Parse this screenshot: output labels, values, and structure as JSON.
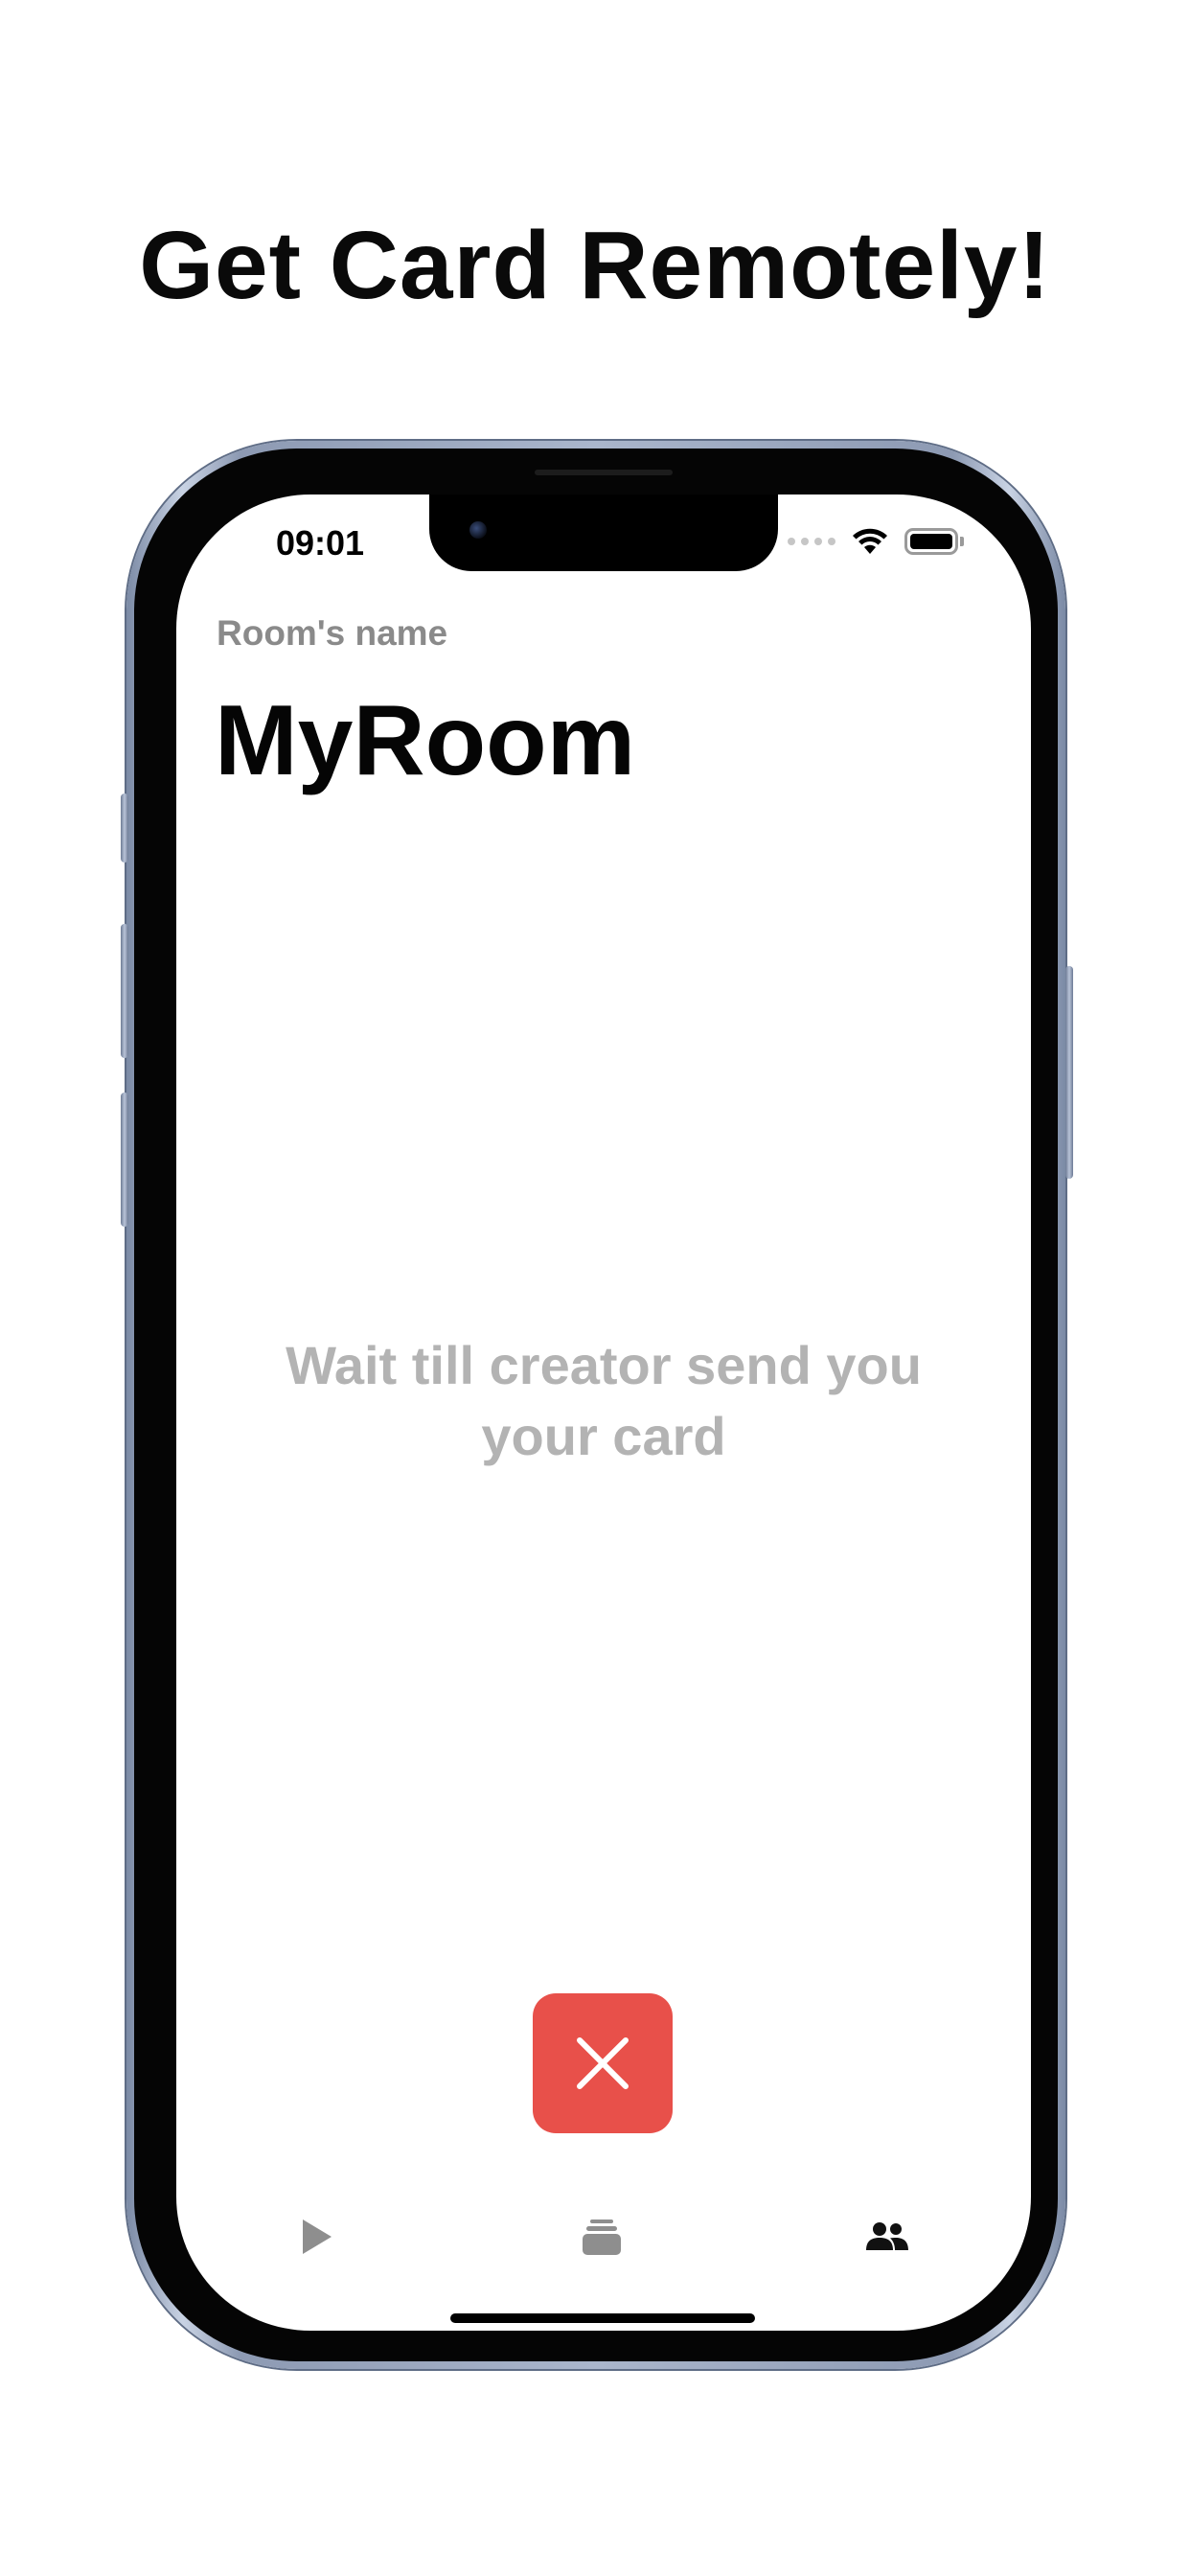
{
  "headline": "Get Card Remotely!",
  "status_bar": {
    "time": "09:01",
    "icons": [
      "signal-dots-icon",
      "wifi-icon",
      "battery-icon"
    ]
  },
  "room": {
    "label": "Room's name",
    "name": "MyRoom"
  },
  "message": {
    "line1": "Wait till creator send you",
    "line2": "your card"
  },
  "close_button": {
    "icon": "close-icon",
    "color": "#e8504a"
  },
  "tab_bar": {
    "items": [
      {
        "icon": "play-icon",
        "active": false
      },
      {
        "icon": "card-stack-icon",
        "active": false
      },
      {
        "icon": "people-icon",
        "active": true
      }
    ]
  },
  "colors": {
    "accent_red": "#e8504a",
    "muted_text": "#b3b3b3",
    "label_gray": "#8a8a8a"
  }
}
